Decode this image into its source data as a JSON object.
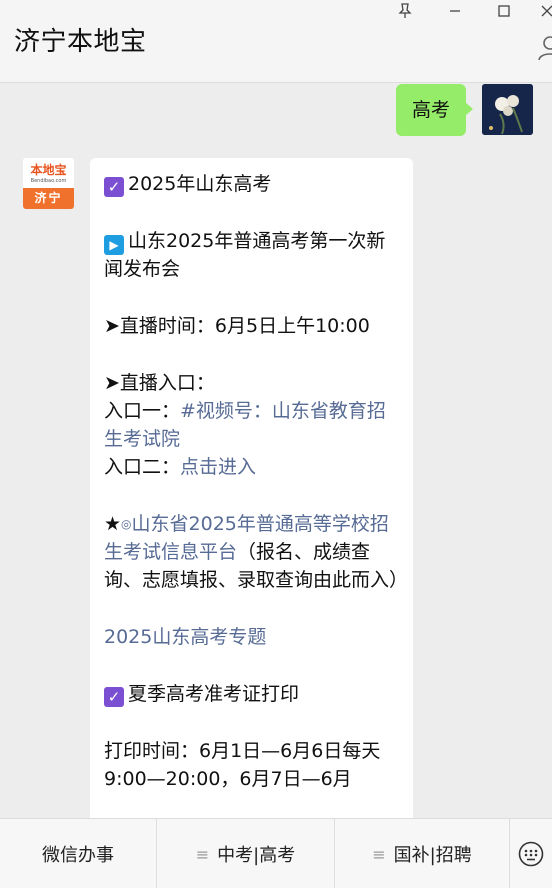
{
  "app": {
    "title": "济宁本地宝"
  },
  "chat": {
    "outgoing_message": "高考",
    "bot_avatar": {
      "line1": "本地宝",
      "line2": "Bendibao.com",
      "line3": "济宁"
    },
    "reply": {
      "heading": "2025年山东高考",
      "sub_heading": "山东2025年普通高考第一次新闻发布会",
      "live_time": "➤直播时间：6月5日上午10:00",
      "live_entry": "➤直播入口：",
      "entry1_label": "入口一：",
      "entry1_link": "#视频号：山东省教育招生考试院",
      "entry2_label": "入口二：",
      "entry2_link": "点击进入",
      "platform_star": "★",
      "platform_circle": "◎",
      "platform_link": "山东省2025年普通高等学校招生考试信息平台",
      "platform_note": "（报名、成绩查询、志愿填报、录取查询由此而入）",
      "topic_link": "2025山东高考专题",
      "admission_heading": "夏季高考准考证打印",
      "print_time": "打印时间：6月1日—6月6日每天9:00—20:00，6月7日—6月"
    }
  },
  "menu": {
    "items": [
      {
        "label": "微信办事",
        "icon": ""
      },
      {
        "label": "中考|高考",
        "icon": "≡"
      },
      {
        "label": "国补|招聘",
        "icon": "≡"
      }
    ],
    "keyboard_icon": "keyboard-icon"
  },
  "colors": {
    "outgoing_bubble": "#95ec69",
    "link": "#576b95",
    "check_emoji": "#7a4fd1",
    "play_emoji": "#1e9de0",
    "brand_orange": "#f0712b"
  }
}
